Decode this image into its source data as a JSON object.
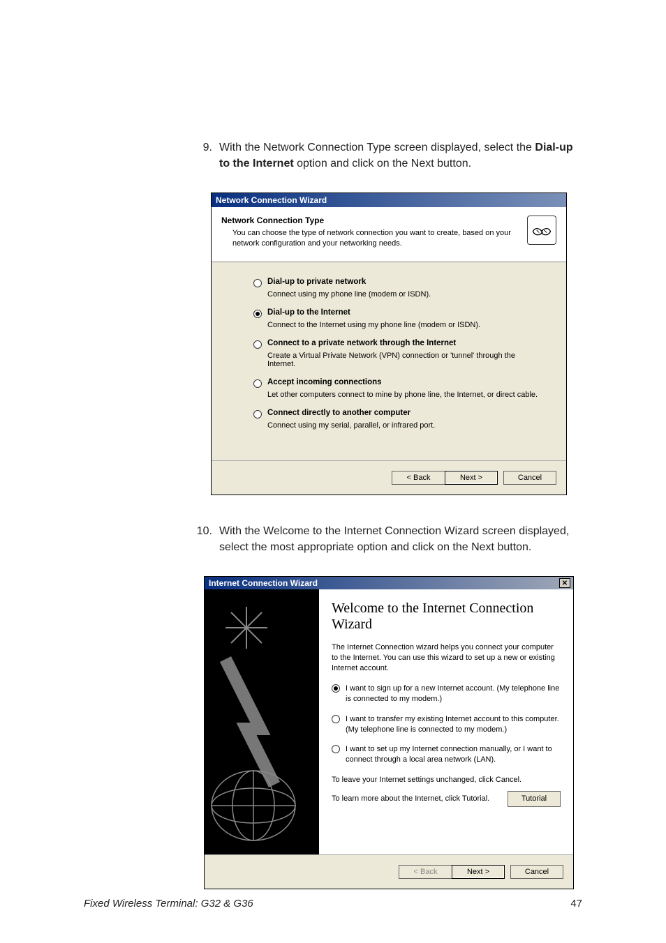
{
  "steps": {
    "s9": {
      "num": "9.",
      "pre": "With the Network Connection Type screen displayed, select the ",
      "bold": "Dial-up to the Internet",
      "post": " option and click on the Next button."
    },
    "s10": {
      "num": "10.",
      "text": "With the Welcome to the Internet Connection Wizard screen displayed, select the most appropriate option and click on the Next button."
    }
  },
  "wiz1": {
    "title": "Network Connection Wizard",
    "header_title": "Network Connection Type",
    "header_sub": "You can choose the type of network connection you want to create, based on your network configuration and your networking needs.",
    "options": [
      {
        "title": "Dial-up to private network",
        "desc": "Connect using my phone line (modem or ISDN).",
        "selected": false
      },
      {
        "title": "Dial-up to the Internet",
        "desc": "Connect to the Internet using my phone line (modem or ISDN).",
        "selected": true
      },
      {
        "title": "Connect to a private network through the Internet",
        "desc": "Create a Virtual Private Network (VPN) connection or 'tunnel' through the Internet.",
        "selected": false
      },
      {
        "title": "Accept incoming connections",
        "desc": "Let other computers connect to mine by phone line, the Internet, or direct cable.",
        "selected": false
      },
      {
        "title": "Connect directly to another computer",
        "desc": "Connect using my serial, parallel, or infrared port.",
        "selected": false
      }
    ],
    "buttons": {
      "back": "< Back",
      "next": "Next >",
      "cancel": "Cancel"
    }
  },
  "wiz2": {
    "title": "Internet Connection Wizard",
    "heading": "Welcome to the Internet Connection Wizard",
    "intro": "The Internet Connection wizard helps you connect your computer to the Internet. You can use this wizard to set up a new or existing Internet account.",
    "options": [
      {
        "text": "I want to sign up for a new Internet account. (My telephone line is connected to my modem.)",
        "selected": true
      },
      {
        "text": "I want to transfer my existing Internet account to this computer. (My telephone line is connected to my modem.)",
        "selected": false
      },
      {
        "text": "I want to set up my Internet connection manually, or I want to connect through a local area network (LAN).",
        "selected": false
      }
    ],
    "note_cancel": "To leave your Internet settings unchanged, click Cancel.",
    "note_tutorial": "To learn more about the Internet, click Tutorial.",
    "tutorial_btn": "Tutorial",
    "buttons": {
      "back": "< Back",
      "next": "Next >",
      "cancel": "Cancel"
    }
  },
  "footer": {
    "left": "Fixed Wireless Terminal: G32 & G36",
    "right": "47"
  }
}
